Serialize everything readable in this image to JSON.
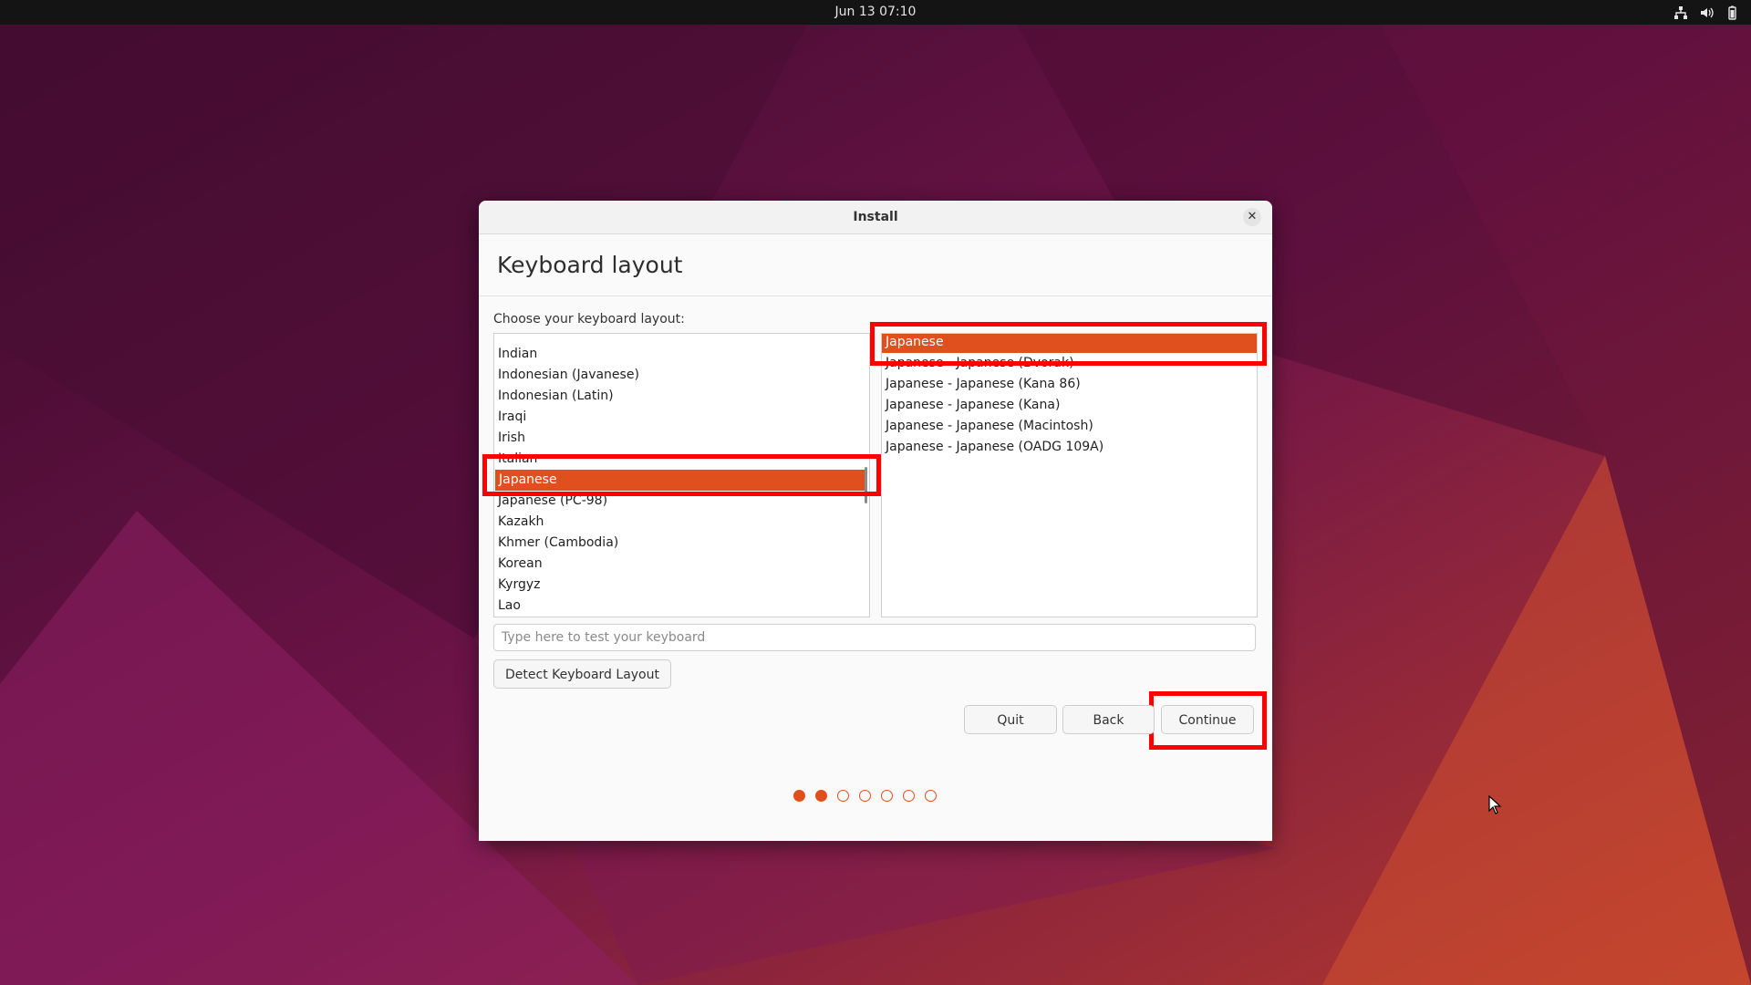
{
  "topbar": {
    "datetime": "Jun 13  07:10",
    "icons": [
      "network-icon",
      "volume-icon",
      "battery-icon"
    ]
  },
  "window": {
    "title": "Install",
    "heading": "Keyboard layout",
    "prompt": "Choose your keyboard layout:",
    "layouts": [
      "Indian",
      "Indonesian (Javanese)",
      "Indonesian (Latin)",
      "Iraqi",
      "Irish",
      "Italian",
      "Japanese",
      "Japanese (PC-98)",
      "Kazakh",
      "Khmer (Cambodia)",
      "Korean",
      "Kyrgyz",
      "Lao"
    ],
    "selected_layout": "Japanese",
    "variants": [
      "Japanese",
      "Japanese - Japanese (Dvorak)",
      "Japanese - Japanese (Kana 86)",
      "Japanese - Japanese (Kana)",
      "Japanese - Japanese (Macintosh)",
      "Japanese - Japanese (OADG 109A)"
    ],
    "selected_variant": "Japanese",
    "test_placeholder": "Type here to test your keyboard",
    "detect_label": "Detect Keyboard Layout",
    "quit_label": "Quit",
    "back_label": "Back",
    "continue_label": "Continue",
    "progress": {
      "total_steps": 7,
      "completed_steps": 2
    }
  },
  "colors": {
    "accent": "#E04F1E",
    "highlight_box": "#FF0000",
    "topbar": "#141414",
    "wallpaper_dark": "#3A0A2A",
    "wallpaper_mid": "#7A1650",
    "wallpaper_light": "#C8402E"
  }
}
